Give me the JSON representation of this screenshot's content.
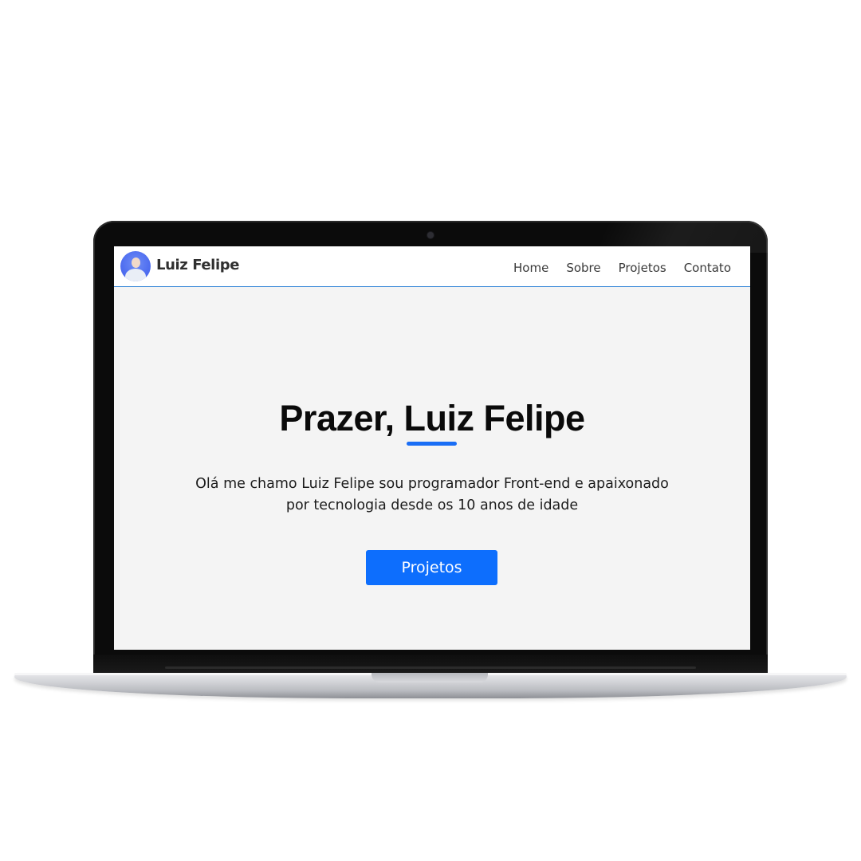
{
  "nav": {
    "brand": "Luiz Felipe",
    "links": [
      "Home",
      "Sobre",
      "Projetos",
      "Contato"
    ]
  },
  "hero": {
    "title": "Prazer, Luiz Felipe",
    "text_line1": "Olá me chamo Luiz Felipe sou programador Front-end e apaixonado",
    "text_line2": "por tecnologia desde os 10 anos de idade",
    "button": "Projetos"
  },
  "colors": {
    "accent": "#0d6efd",
    "nav_border": "#3d8bd9",
    "background": "#f4f4f4"
  },
  "icons": {
    "avatar": "profile-avatar-icon"
  }
}
